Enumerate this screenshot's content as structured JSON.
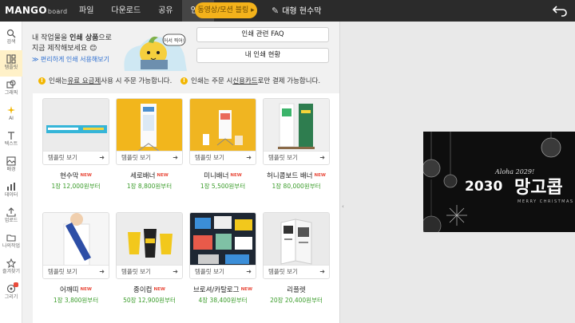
{
  "app": {
    "logo_main": "MANGO",
    "logo_sub": "board",
    "doc_title": "대형 현수막"
  },
  "menu": [
    {
      "label": "파일"
    },
    {
      "label": "다운로드"
    },
    {
      "label": "공유"
    },
    {
      "label": "인쇄"
    }
  ],
  "cta": {
    "label": "동영상/모션 블링 ▸"
  },
  "rail": [
    {
      "label": "검색",
      "icon": "search-icon"
    },
    {
      "label": "템플릿",
      "icon": "template-icon"
    },
    {
      "label": "그래픽",
      "icon": "graphic-icon"
    },
    {
      "label": "AI",
      "icon": "ai-icon"
    },
    {
      "label": "텍스트",
      "icon": "text-icon"
    },
    {
      "label": "배경",
      "icon": "background-icon"
    },
    {
      "label": "데이터",
      "icon": "data-icon"
    },
    {
      "label": "업로드",
      "icon": "upload-icon"
    },
    {
      "label": "나의작업",
      "icon": "folder-icon"
    },
    {
      "label": "즐겨찾기",
      "icon": "star-icon"
    },
    {
      "label": "그리기",
      "icon": "draw-icon"
    }
  ],
  "panel": {
    "intro_pre": "내 작업물을 ",
    "intro_bold": "인쇄 상품",
    "intro_post": "으로",
    "intro_line2": "지금 제작해보세요 😊",
    "guide_link": "≫ 편리하게 인쇄 서용해보기",
    "mascot_bubble": "어서 찍어!",
    "faq_label": "인쇄 관련 FAQ",
    "status_label": "내 인쇄 현황",
    "notice1_pre": "인쇄는 ",
    "notice1_u": "유료 요금제",
    "notice1_post": " 사용 시 주문 가능합니다.",
    "notice2_pre": "인쇄는 주문 시 ",
    "notice2_u": "신용카드",
    "notice2_post": "로만 결제 가능합니다."
  },
  "template_label": "템플릿 보기",
  "new_label": "NEW",
  "products": [
    {
      "name": "현수막",
      "new": true,
      "price": "1장 12,000원부터"
    },
    {
      "name": "세로배너",
      "new": true,
      "price": "1장 8,800원부터"
    },
    {
      "name": "미니배너",
      "new": true,
      "price": "1장 5,500원부터"
    },
    {
      "name": "허니콤보드 배너",
      "new": true,
      "price": "1장 80,000원부터"
    },
    {
      "name": "어깨띠",
      "new": true,
      "price": "1장 3,800원부터"
    },
    {
      "name": "종이컵",
      "new": true,
      "price": "50장 12,900원부터"
    },
    {
      "name": "브로셔/카탈로그",
      "new": true,
      "price": "4장 38,400원부터"
    },
    {
      "name": "리플렛",
      "new": false,
      "price": "20장 20,400원부터"
    }
  ],
  "artwork": {
    "script": "Aloha 2029!",
    "year": "2030",
    "title": "망고콥",
    "subtitle": "MERRY CHRISTMAS"
  },
  "colors": {
    "topbar": "#2b2b2b",
    "accent": "#f3b21b",
    "price": "#3a9c2a",
    "new_badge": "#e94b3c",
    "link": "#2d6fd1"
  }
}
